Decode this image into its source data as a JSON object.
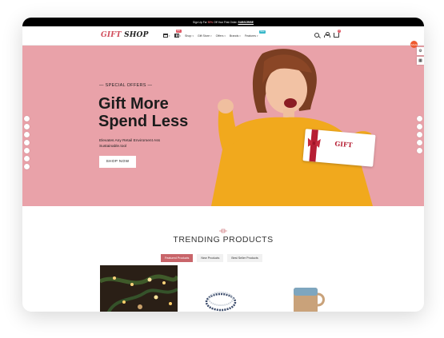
{
  "announcement": {
    "prefix": "Sign Up For",
    "highlight": "50%",
    "middle": "Off Your First Order.",
    "link": "SUBSCRIBE"
  },
  "logo": {
    "part1": "GIFT",
    "part2": "SHOP"
  },
  "nav": {
    "items": [
      {
        "label": "Shop",
        "caret": "▾"
      },
      {
        "label": "Gift Store",
        "caret": "▾"
      },
      {
        "label": "Offers",
        "caret": "▾"
      },
      {
        "label": "Brands",
        "caret": "▾"
      },
      {
        "label": "Features",
        "caret": "▾",
        "badge": "New"
      }
    ],
    "hot_badge": "Hot"
  },
  "cart": {
    "count": "0"
  },
  "hero": {
    "eyebrow": "— SPECIAL OFFERS —",
    "title_line1": "Gift More",
    "title_line2": "Spend Less",
    "subtitle_line1": "Elevates Any Retail Enviroment Ass",
    "subtitle_line2": "Sustainable.tool",
    "button": "SHOP NOW",
    "voucher_text": "GIFT"
  },
  "floating": {
    "sale": "SALE",
    "gear": "⚙",
    "grid": "▦"
  },
  "trending": {
    "title": "TRENDING PRODUCTS",
    "tabs": [
      {
        "label": "Featured Products",
        "active": true
      },
      {
        "label": "New Products",
        "active": false
      },
      {
        "label": "Best Seller Products",
        "active": false
      }
    ]
  },
  "colors": {
    "brand": "#d14b5a",
    "hero_bg": "#e9a2a9",
    "active_tab": "#c9656a"
  }
}
